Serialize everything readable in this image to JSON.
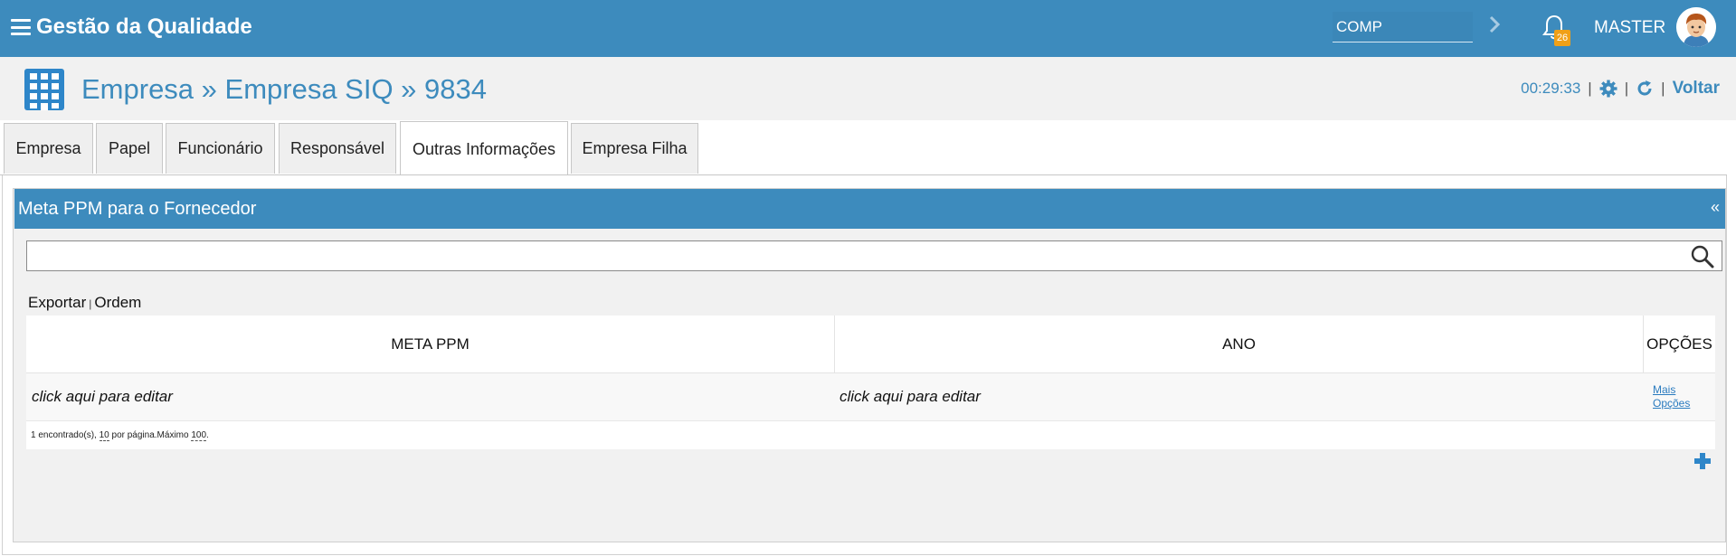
{
  "app": {
    "title": "Gestão da Qualidade"
  },
  "topbar": {
    "company_value": "COMP",
    "notification_count": "26",
    "user_name": "MASTER"
  },
  "header": {
    "title": "Empresa » Empresa SIQ » 9834",
    "timer": "00:29:33",
    "separator": "|",
    "back_label": "Voltar"
  },
  "tabs": [
    {
      "label": "Empresa"
    },
    {
      "label": "Papel"
    },
    {
      "label": "Funcionário"
    },
    {
      "label": "Responsável"
    },
    {
      "label": "Outras Informações",
      "active": true
    },
    {
      "label": "Empresa Filha"
    }
  ],
  "section": {
    "title": "Meta PPM para o Fornecedor",
    "collapse_label": "«",
    "search_value": "",
    "links": {
      "export": "Exportar",
      "separator": "|",
      "order": "Ordem"
    },
    "table": {
      "columns": [
        "META PPM",
        "ANO",
        "OPÇÕES"
      ],
      "rows": [
        {
          "meta_ppm": "click aqui para editar",
          "ano": "click aqui para editar",
          "options_line1": "Mais",
          "options_line2": "Opções"
        }
      ],
      "footer": {
        "found": "1 encontrado(s),",
        "per_page_value": "10",
        "per_page_label": "por página.Máximo",
        "max_value": "100",
        "end": "."
      }
    }
  },
  "colors": {
    "primary": "#3d8bbd",
    "badge": "#f0a018",
    "link": "#2a7bbf"
  },
  "icons": {
    "menu": "menu-icon",
    "chevron": "chevron-right-icon",
    "bell": "bell-icon",
    "avatar": "avatar",
    "building": "building-icon",
    "gear": "gear-icon",
    "refresh": "refresh-icon",
    "search": "search-icon",
    "plus": "plus-icon"
  }
}
